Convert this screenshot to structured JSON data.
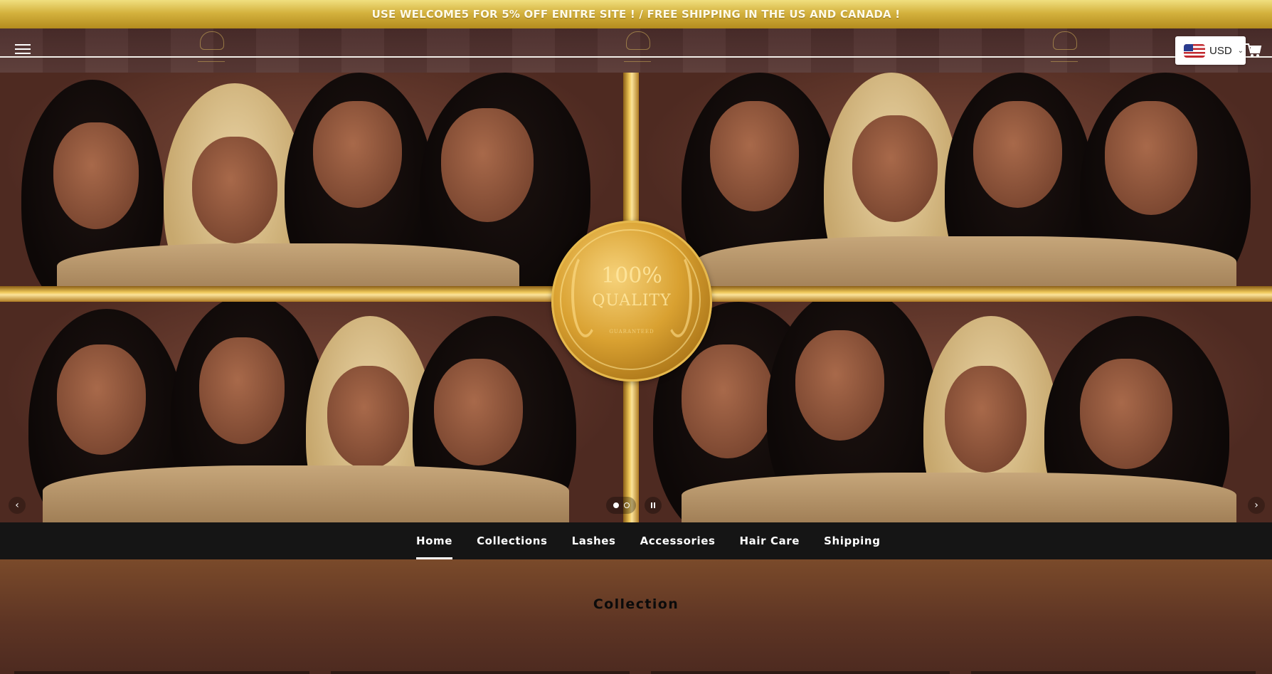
{
  "announcement": {
    "text": "USE WELCOME5 FOR 5% OFF ENITRE SITE ! / FREE SHIPPING IN THE US AND CANADA !"
  },
  "header": {
    "menu_icon": "hamburger-menu-icon",
    "currency": {
      "code": "USD",
      "flag_icon": "us-flag-icon",
      "chevron_icon": "chevron-down-icon"
    },
    "cart_icon": "cart-icon"
  },
  "hero": {
    "badge": {
      "percent": "100%",
      "word": "QUALITY",
      "small": "GUARANTEED"
    },
    "prev_icon": "chevron-left-icon",
    "next_icon": "chevron-right-icon",
    "pause_icon": "pause-icon",
    "slide_count": 2,
    "active_slide": 1
  },
  "nav": {
    "items": [
      {
        "label": "Home",
        "active": true
      },
      {
        "label": "Collections",
        "active": false
      },
      {
        "label": "Lashes",
        "active": false
      },
      {
        "label": "Accessories",
        "active": false
      },
      {
        "label": "Hair Care",
        "active": false
      },
      {
        "label": "Shipping",
        "active": false
      }
    ]
  },
  "collection": {
    "title": "Collection"
  },
  "colors": {
    "announcement_gold": "#d4b23e",
    "nav_background": "#151515",
    "section_brown": "#6a3c2c",
    "seal_gold": "#d9a131"
  }
}
